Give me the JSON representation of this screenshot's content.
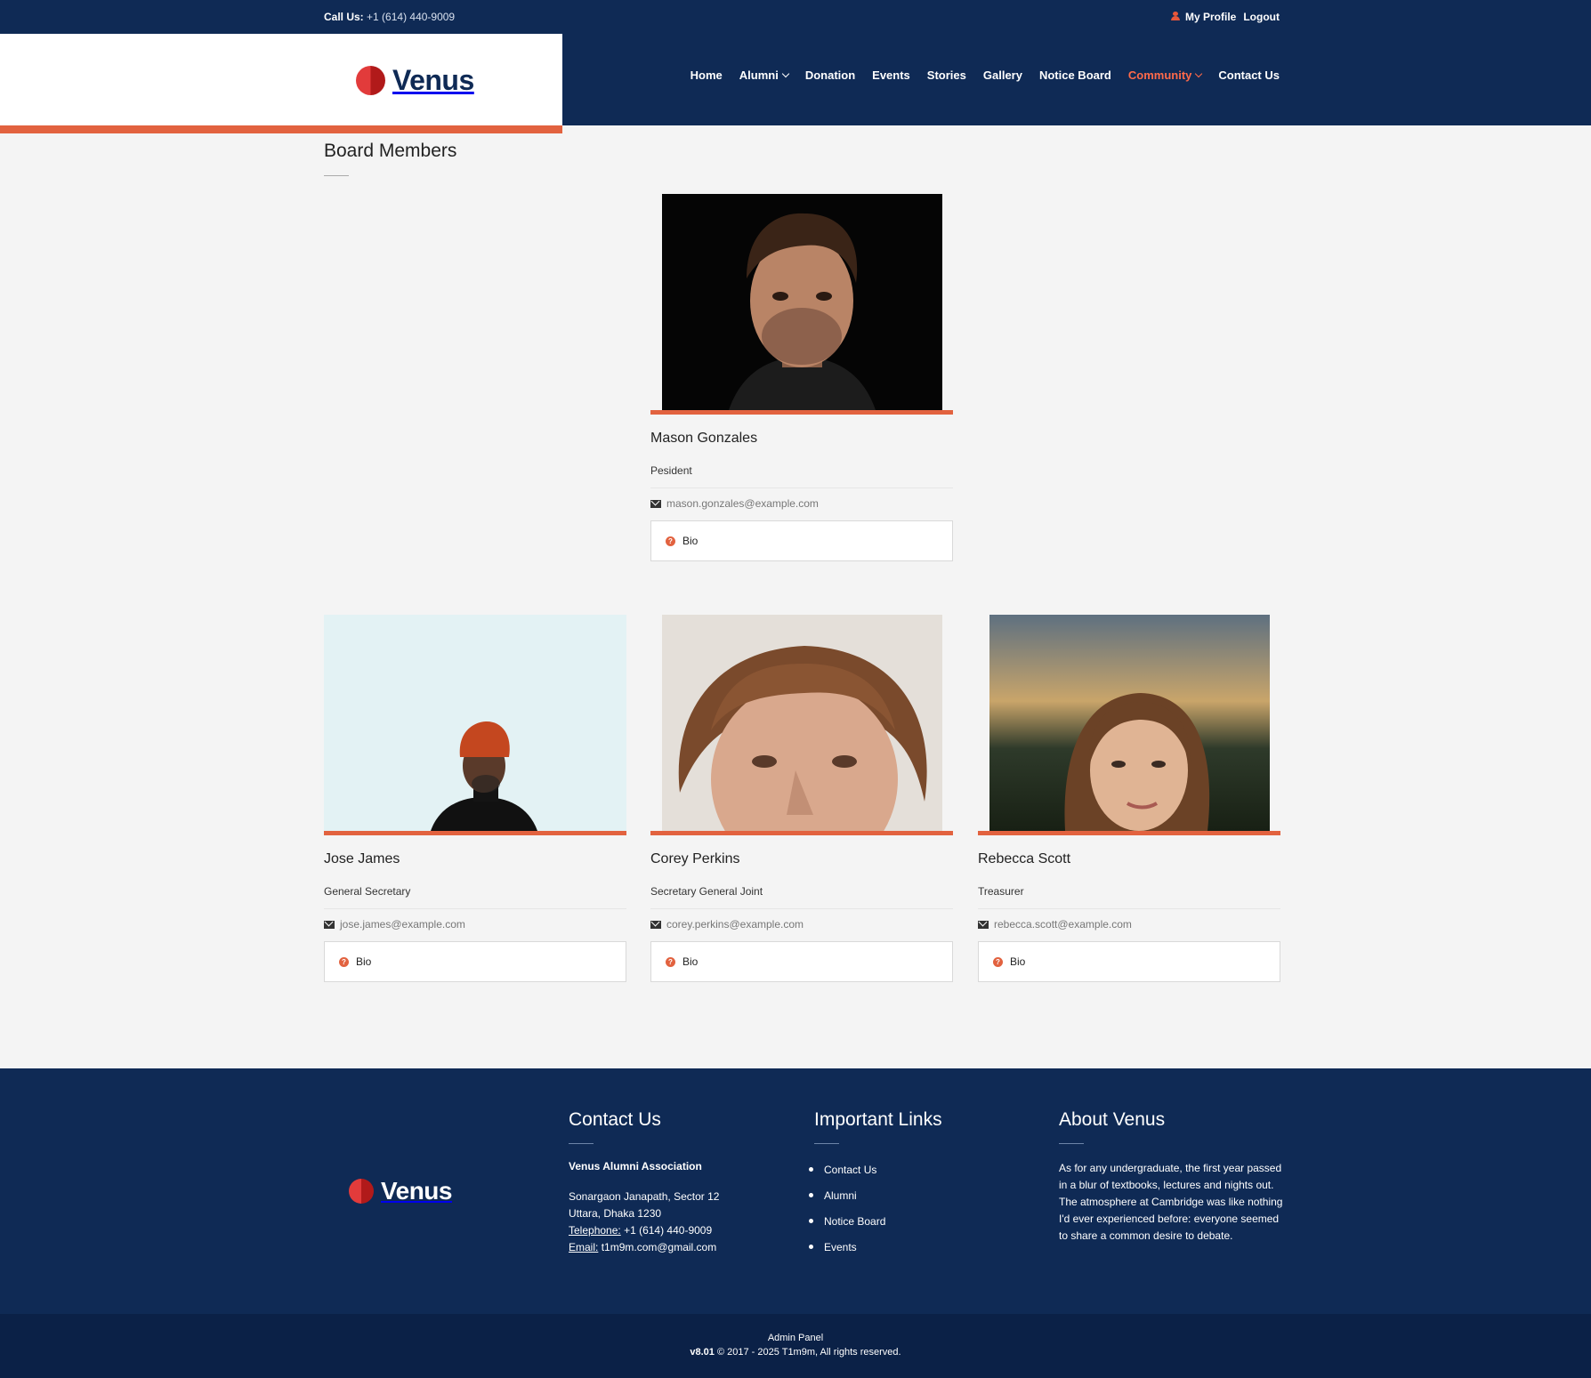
{
  "topbar": {
    "call_label": "Call Us:",
    "call_number": "+1 (614) 440-9009",
    "my_profile": "My Profile",
    "logout": "Logout"
  },
  "brand": {
    "name": "Venus"
  },
  "nav": {
    "items": [
      {
        "label": "Home"
      },
      {
        "label": "Alumni"
      },
      {
        "label": "Donation"
      },
      {
        "label": "Events"
      },
      {
        "label": "Stories"
      },
      {
        "label": "Gallery"
      },
      {
        "label": "Notice Board"
      },
      {
        "label": "Community"
      },
      {
        "label": "Contact Us"
      }
    ]
  },
  "page": {
    "title": "Board Members"
  },
  "members": [
    {
      "name": "Mason Gonzales",
      "role": "Pesident",
      "email": "mason.gonzales@example.com",
      "bio_label": "Bio"
    },
    {
      "name": "Jose James",
      "role": "General Secretary",
      "email": "jose.james@example.com",
      "bio_label": "Bio"
    },
    {
      "name": "Corey Perkins",
      "role": "Secretary General Joint",
      "email": "corey.perkins@example.com",
      "bio_label": "Bio"
    },
    {
      "name": "Rebecca Scott",
      "role": "Treasurer",
      "email": "rebecca.scott@example.com",
      "bio_label": "Bio"
    }
  ],
  "footer": {
    "contact": {
      "heading": "Contact Us",
      "org": "Venus Alumni Association",
      "address_line1": "Sonargaon Janapath, Sector 12",
      "address_line2": "Uttara, Dhaka 1230",
      "telephone_label": "Telephone:",
      "telephone": "+1 (614) 440-9009",
      "email_label": "Email:",
      "email": "t1m9m.com@gmail.com"
    },
    "links": {
      "heading": "Important Links",
      "items": [
        "Contact Us",
        "Alumni",
        "Notice Board",
        "Events"
      ]
    },
    "about": {
      "heading": "About Venus",
      "text": "As for any undergraduate, the first year passed in a blur of textbooks, lectures and nights out. The atmosphere at Cambridge was like nothing I'd ever experienced before: everyone seemed to share a common desire to debate."
    }
  },
  "bottom": {
    "line1": "Admin Panel",
    "version": "v8.01",
    "copyright": "© 2017 - 2025 T1m9m, All rights reserved."
  },
  "colors": {
    "navy": "#0f2a55",
    "accent": "#e2623f",
    "active_nav": "#ff6a4a"
  }
}
